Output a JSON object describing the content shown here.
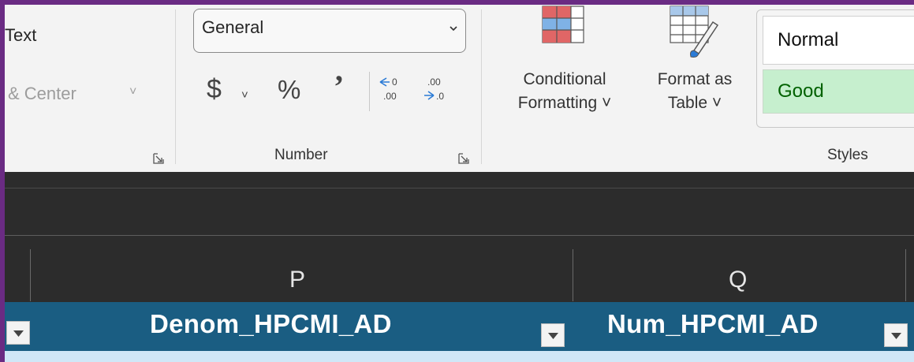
{
  "ribbon": {
    "alignment": {
      "wrap_text_fragment": "Text",
      "merge_center_fragment": "& Center"
    },
    "number": {
      "format_value": "General",
      "currency_symbol": "$",
      "percent_symbol": "%",
      "comma_symbol": "’",
      "group_label": "Number"
    },
    "styles": {
      "conditional_formatting_line1": "Conditional",
      "conditional_formatting_line2": "Formatting ˅",
      "format_as_table_line1": "Format as",
      "format_as_table_line2": "Table ˅",
      "cell_style_normal": "Normal",
      "cell_style_good": "Good",
      "group_label": "Styles"
    }
  },
  "sheet": {
    "columns": [
      "P",
      "Q"
    ],
    "table_headers": [
      "Denom_HPCMI_AD",
      "Num_HPCMI_AD"
    ]
  },
  "colors": {
    "frame": "#6a2b83",
    "table_header_bg": "#1a5d82",
    "good_bg": "#c6efce",
    "good_text": "#006100"
  }
}
